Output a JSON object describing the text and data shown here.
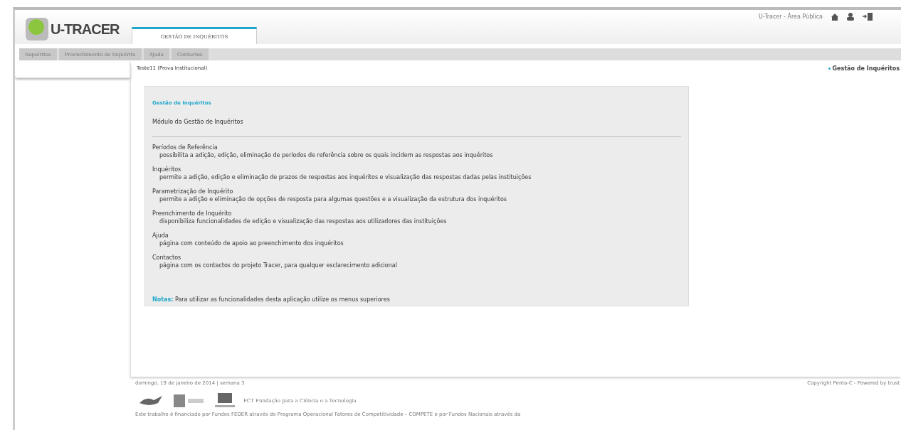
{
  "header": {
    "logo": "U-TRACER",
    "area": "U-Tracer - Área Pública"
  },
  "tabs": [
    {
      "label": "GESTÃO DE INQUÉRITOS",
      "selected": true
    }
  ],
  "menu": [
    {
      "label": "Inquéritos"
    },
    {
      "label": "Preenchimento de Inquérito"
    },
    {
      "label": "Ajuda"
    },
    {
      "label": "Contactos"
    }
  ],
  "page_title": "Teste11 (Prova Institucional)",
  "breadcrumb": "Gestão de Inquéritos",
  "panel": {
    "heading": "Gestão de Inquéritos",
    "subtitle": "Módulo da Gestão de Inquéritos",
    "items": [
      {
        "title": "Períodos de Referência",
        "description": "possibilita a adição, edição, eliminação de períodos de referência sobre os quais incidem as respostas aos inquéritos"
      },
      {
        "title": "Inquéritos",
        "description": "permite a adição, edição e eliminação de prazos de respostas aos inquéritos e visualização das respostas dadas pelas instituições"
      },
      {
        "title": "Parametrização de Inquérito",
        "description": "permite a adição e eliminação de opções de resposta para algumas questões e a visualização da estrutura dos inquéritos"
      },
      {
        "title": "Preenchimento de Inquérito",
        "description": "disponibiliza funcionalidades de edição e visualização das respostas aos utilizadores das instituições"
      },
      {
        "title": "Ajuda",
        "description": "página com conteúdo de apoio ao preenchimento dos inquéritos"
      },
      {
        "title": "Contactos",
        "description": "página com os contactos do projeto Tracer, para qualquer esclarecimento adicional"
      }
    ],
    "note_label": "Notas:",
    "note": "Para utilizar as funcionalidades desta aplicação utilize os menus superiores"
  },
  "footer": {
    "date": "domingo, 19 de janeiro de 2014 | semana 3",
    "copyright": "Copyright Penta-C - Powered by trust",
    "fct": "FCT Fundação para a Ciência e a Tecnologia",
    "funding": "Este trabalho é financiado por Fundos FEDER através do Programa Operacional Fatores de Competitividade – COMPETE e por Fundos Nacionais através da"
  }
}
